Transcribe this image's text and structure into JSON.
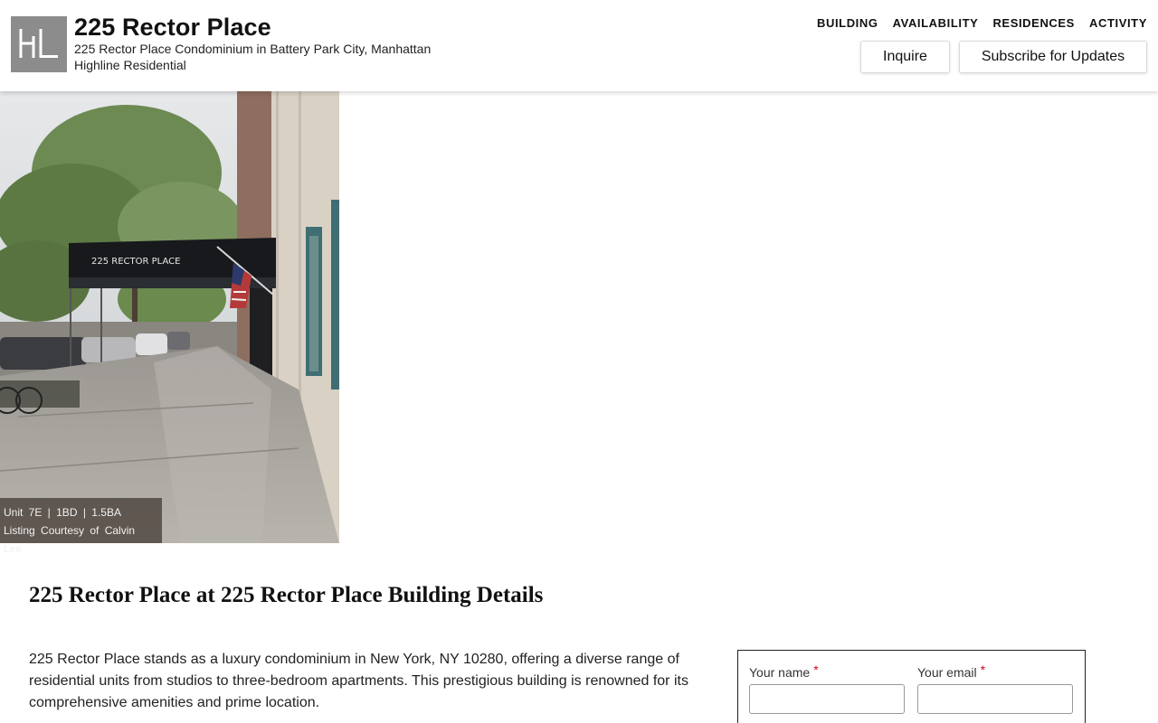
{
  "header": {
    "logo_text": "HL",
    "title": "225 Rector Place",
    "subtitle": "225 Rector Place Condominium in Battery Park City, Manhattan",
    "brand": "Highline Residential",
    "nav": [
      "BUILDING",
      "AVAILABILITY",
      "RESIDENCES",
      "ACTIVITY"
    ],
    "inquire_label": "Inquire",
    "subscribe_label": "Subscribe for Updates"
  },
  "photo": {
    "awning_text": "225 RECTOR PLACE",
    "caption_line1": "Unit 7E | 1BD | 1.5BA",
    "caption_line2": "Listing Courtesy of Calvin Lee"
  },
  "main": {
    "section_title": "225 Rector Place at 225 Rector Place Building Details",
    "description": "225 Rector Place stands as a luxury condominium in New York, NY 10280, offering a diverse range of residential units from studios to three-bedroom apartments. This prestigious building is renowned for its comprehensive amenities and prime location."
  },
  "form": {
    "name_label": "Your name",
    "email_label": "Your email",
    "required_marker": "*"
  },
  "colors": {
    "logo_bg": "#8c8c8c",
    "required": "#d0021b"
  }
}
